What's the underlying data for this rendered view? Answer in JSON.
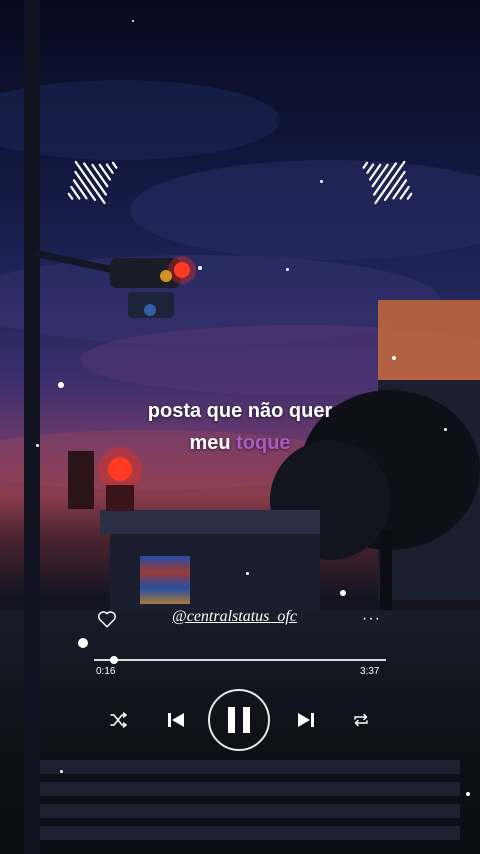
{
  "lyrics": {
    "line1": "posta que não quer",
    "line2_start": "meu",
    "line2_highlight": "toque"
  },
  "player": {
    "handle": "@centralstatus_ofc",
    "more_label": "···",
    "elapsed": "0:16",
    "duration": "3:37",
    "progress": 0.07
  },
  "icons": {
    "like": "heart-icon",
    "shuffle": "shuffle-icon",
    "previous": "skip-previous-icon",
    "play_pause": "pause-icon",
    "next": "skip-next-icon",
    "repeat": "repeat-icon",
    "decor_left": "audio-wave-icon",
    "decor_right": "audio-wave-icon"
  },
  "colors": {
    "highlight": "#a55cc4",
    "text": "#ffffff"
  }
}
